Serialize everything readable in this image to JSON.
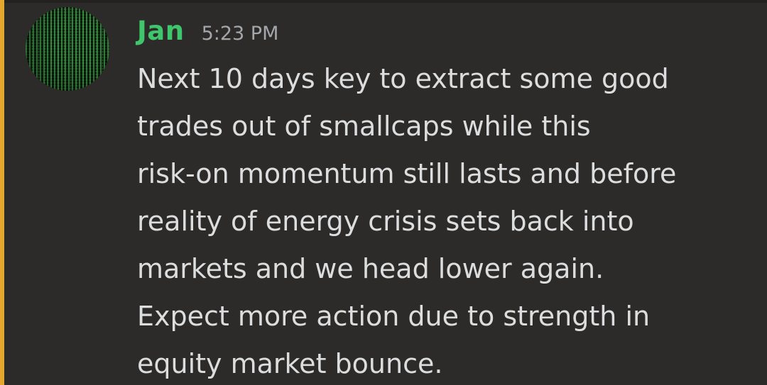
{
  "message": {
    "author": "Jan",
    "timestamp": "5:23 PM",
    "avatar_icon": "matrix-code-avatar-icon",
    "lines": [
      "Next 10 days key to extract some good",
      "trades out of smallcaps while this",
      "risk-on momentum still lasts and before",
      "reality of energy crisis sets back into",
      "markets and we head lower again.",
      "Expect more action due to strength in",
      "equity market bounce."
    ]
  },
  "colors": {
    "background": "#2d2b29",
    "mention_bar": "#e5a630",
    "author": "#3fc56b",
    "timestamp": "#a3a6aa",
    "text": "#dcddde"
  }
}
